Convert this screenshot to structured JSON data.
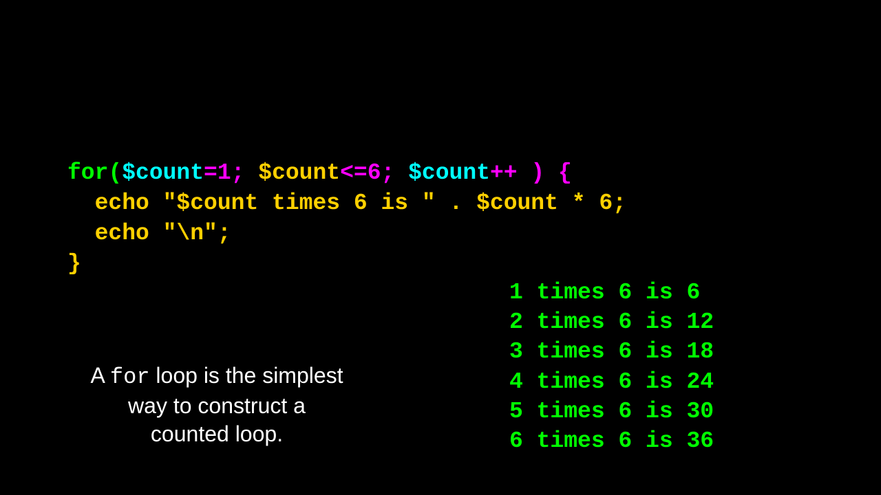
{
  "colors": {
    "green": "#00ff00",
    "cyan": "#00ffff",
    "magenta": "#ff00ff",
    "yellow": "#ffd000",
    "white": "#ffffff"
  },
  "code": {
    "lines": [
      [
        {
          "text": "for(",
          "color": "green"
        },
        {
          "text": "$count",
          "color": "cyan"
        },
        {
          "text": "=1; ",
          "color": "magenta"
        },
        {
          "text": "$count",
          "color": "yellow"
        },
        {
          "text": "<=6; ",
          "color": "magenta"
        },
        {
          "text": "$count",
          "color": "cyan"
        },
        {
          "text": "++ ) {",
          "color": "magenta"
        }
      ],
      [
        {
          "text": "  echo \"$count times 6 is \" . $count * 6;",
          "color": "yellow"
        }
      ],
      [
        {
          "text": "  echo \"\\n\";",
          "color": "yellow"
        }
      ],
      [
        {
          "text": "}",
          "color": "yellow"
        }
      ]
    ]
  },
  "caption": {
    "part1": "A ",
    "keyword": "for",
    "part2": " loop is the simplest way to construct a counted loop."
  },
  "output": {
    "lines": [
      "1 times 6 is 6",
      "2 times 6 is 12",
      "3 times 6 is 18",
      "4 times 6 is 24",
      "5 times 6 is 30",
      "6 times 6 is 36"
    ]
  }
}
